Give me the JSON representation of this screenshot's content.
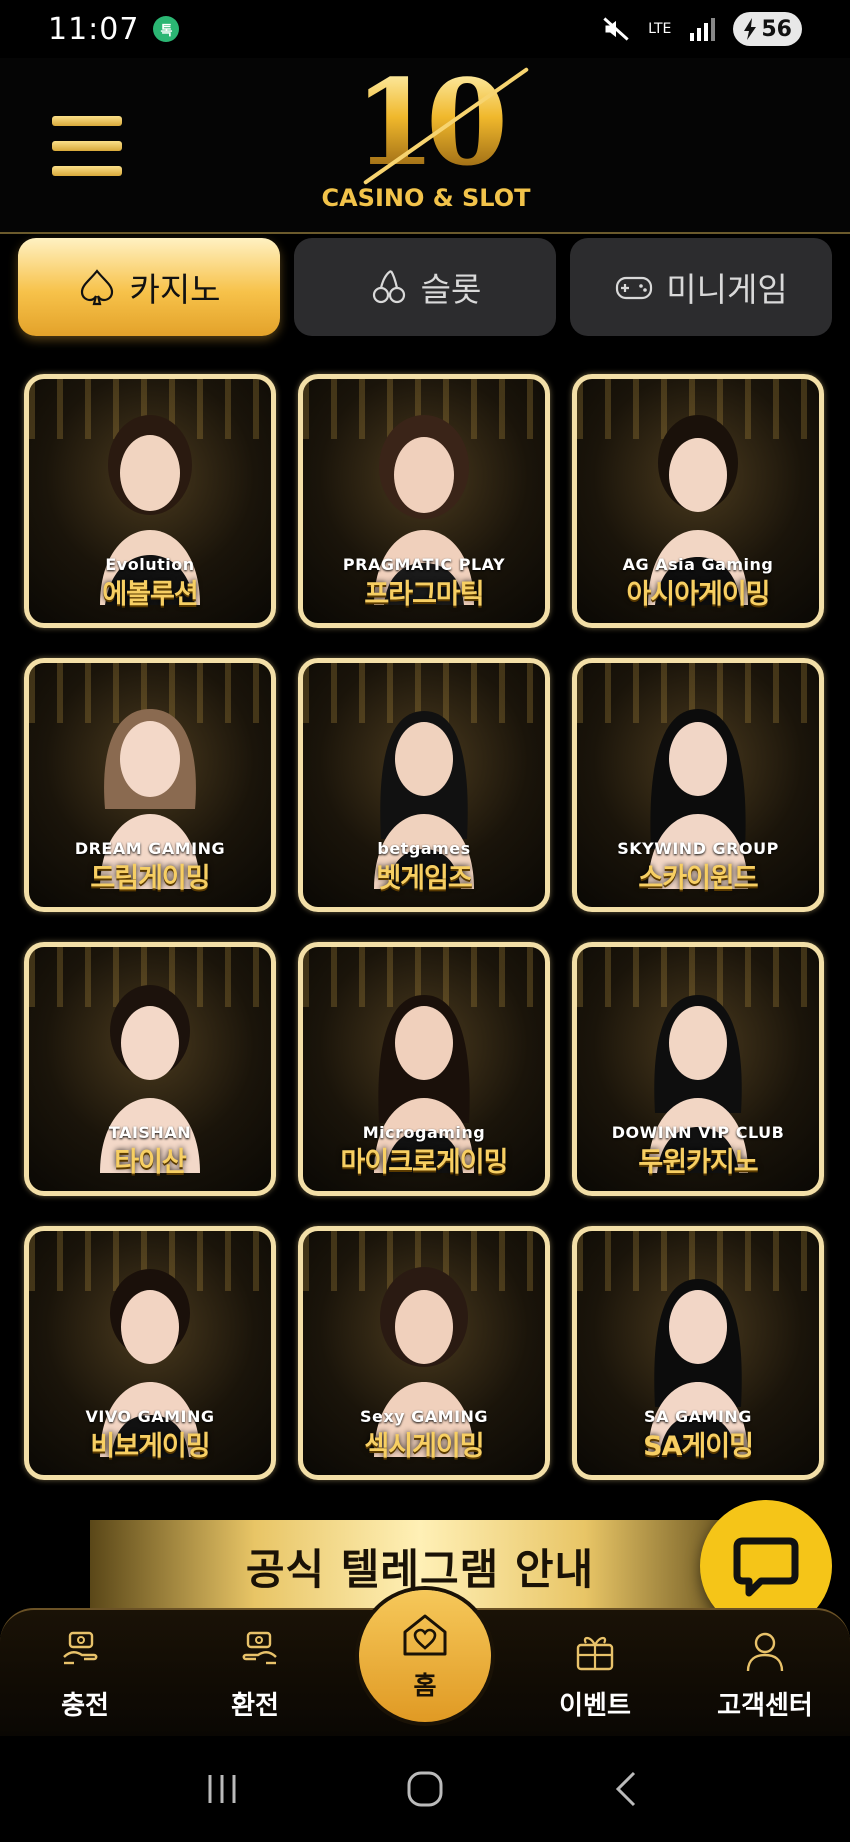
{
  "status_bar": {
    "time": "11:07",
    "notification_badge": "톡",
    "network": "LTE",
    "battery": "56"
  },
  "header": {
    "logo_number": "10",
    "logo_subtitle": "CASINO & SLOT"
  },
  "tabs": [
    {
      "label": "카지노",
      "icon": "spade-icon",
      "active": true
    },
    {
      "label": "슬롯",
      "icon": "cherry-icon",
      "active": false
    },
    {
      "label": "미니게임",
      "icon": "gamepad-icon",
      "active": false
    }
  ],
  "games": [
    {
      "name": "에볼루션",
      "provider": "Evolution"
    },
    {
      "name": "프라그마틱",
      "provider": "PRAGMATIC PLAY"
    },
    {
      "name": "아시아게이밍",
      "provider": "AG Asia Gaming"
    },
    {
      "name": "드림게이밍",
      "provider": "DREAM GAMING"
    },
    {
      "name": "벳게임즈",
      "provider": "betgames"
    },
    {
      "name": "스카이윈드",
      "provider": "SKYWIND GROUP"
    },
    {
      "name": "타이산",
      "provider": "TAISHAN"
    },
    {
      "name": "마이크로게이밍",
      "provider": "Microgaming"
    },
    {
      "name": "두윈카지노",
      "provider": "DOWINN VIP CLUB"
    },
    {
      "name": "비보게이밍",
      "provider": "VIVO GAMING"
    },
    {
      "name": "섹시게이밍",
      "provider": "Sexy GAMING"
    },
    {
      "name": "SA게이밍",
      "provider": "SA GAMING"
    }
  ],
  "banner": {
    "text": "공식 텔레그램 안내"
  },
  "bottom_nav": {
    "charge": "충전",
    "exchange": "환전",
    "home": "홈",
    "event": "이벤트",
    "support": "고객센터"
  },
  "colors": {
    "accent_gold": "#f3c34a",
    "card_border": "#f3dfa7",
    "chat_fab": "#f5c518"
  }
}
